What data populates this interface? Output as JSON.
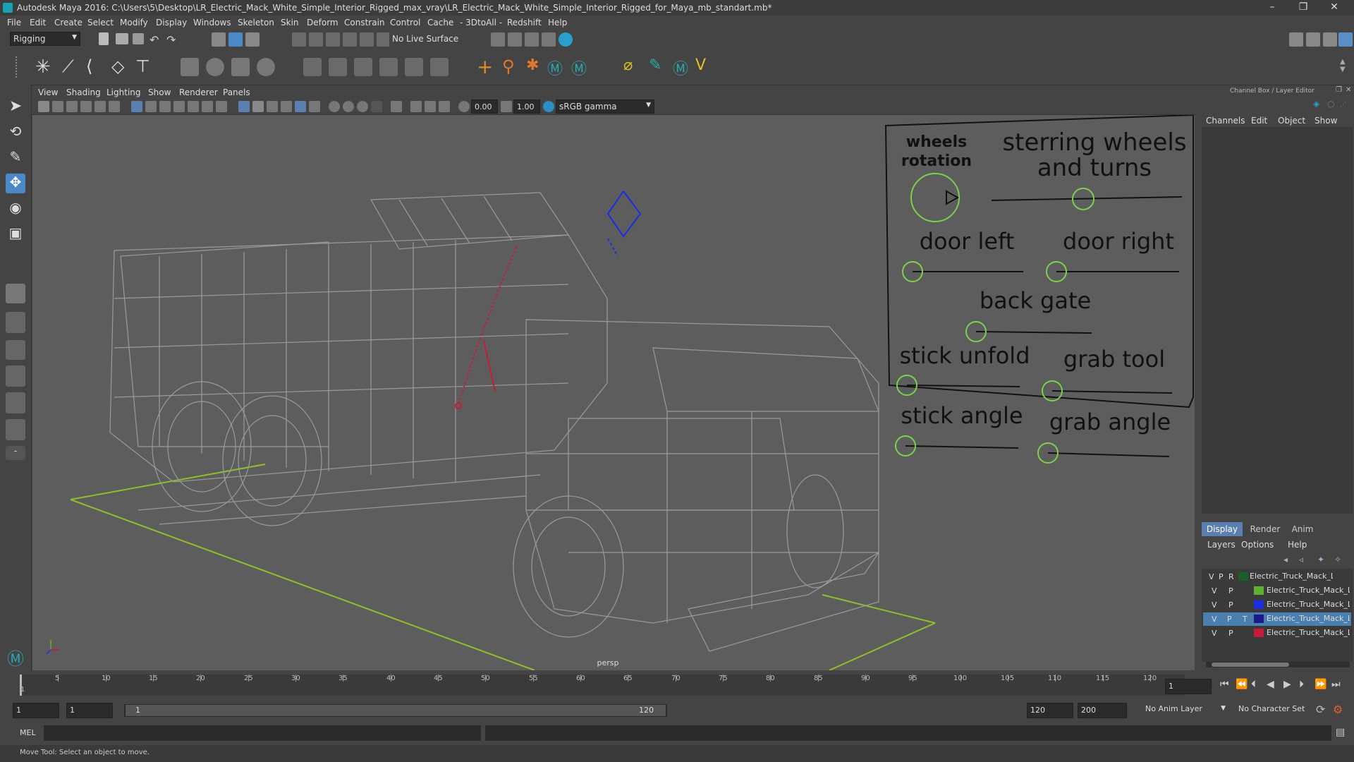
{
  "window": {
    "title": "Autodesk Maya 2016: C:\\Users\\5\\Desktop\\LR_Electric_Mack_White_Simple_Interior_Rigged_max_vray\\LR_Electric_Mack_White_Simple_Interior_Rigged_for_Maya_mb_standart.mb*",
    "minimize": "–",
    "restore": "❐",
    "close": "✕"
  },
  "menu": [
    "File",
    "Edit",
    "Create",
    "Select",
    "Modify",
    "Display",
    "Windows",
    "Skeleton",
    "Skin",
    "Deform",
    "Constrain",
    "Control",
    "Cache",
    "- 3DtoAll -",
    "Redshift",
    "Help"
  ],
  "status_line": {
    "menu_set": "Rigging",
    "live_surface": "No Live Surface"
  },
  "viewport": {
    "menu": [
      "View",
      "Shading",
      "Lighting",
      "Show",
      "Renderer",
      "Panels"
    ],
    "exposure": "0.00",
    "gamma": "1.00",
    "color_space": "sRGB gamma",
    "camera_label": "persp"
  },
  "control_panel": {
    "wheels_rotation": [
      "wheels",
      "rotation"
    ],
    "steering": [
      "sterring wheels",
      "and turns"
    ],
    "door_left": "door left",
    "door_right": "door right",
    "back_gate": "back gate",
    "stick_unfold": "stick unfold",
    "grab_tool": "grab tool",
    "stick_angle": "stick angle",
    "grab_angle": "grab angle"
  },
  "channel_box": {
    "header": "Channel Box / Layer Editor",
    "menu": [
      "Channels",
      "Edit",
      "Object",
      "Show"
    ]
  },
  "layer_editor": {
    "tabs": [
      "Display",
      "Render",
      "Anim"
    ],
    "menu": [
      "Layers",
      "Options",
      "Help"
    ],
    "layers": [
      {
        "v": "V",
        "p": "P",
        "r": "R",
        "color": "#1c5e2a",
        "name": "Electric_Truck_Mack_LR_Blu"
      },
      {
        "v": "V",
        "p": "P",
        "r": "",
        "color": "#5fb030",
        "name": "Electric_Truck_Mack_LR"
      },
      {
        "v": "V",
        "p": "P",
        "r": "",
        "color": "#1a2fe0",
        "name": "Electric_Truck_Mack_LR"
      },
      {
        "v": "V",
        "p": "P",
        "r": "T",
        "color": "#1a1a8a",
        "name": "Electric_Truck_Mack_LR",
        "selected": true
      },
      {
        "v": "V",
        "p": "P",
        "r": "",
        "color": "#c81b3a",
        "name": "Electric_Truck_Mack_LR"
      }
    ]
  },
  "timeline": {
    "ticks": [
      "5",
      "10",
      "15",
      "20",
      "25",
      "30",
      "35",
      "40",
      "45",
      "50",
      "55",
      "60",
      "65",
      "70",
      "75",
      "80",
      "85",
      "90",
      "95",
      "100",
      "105",
      "110",
      "115",
      "120"
    ],
    "first_tick": "1",
    "current_frame": "1"
  },
  "range": {
    "start": "1",
    "playback_start": "1",
    "slider_start": "1",
    "slider_end": "120",
    "playback_end": "120",
    "end": "200",
    "anim_layer": "No Anim Layer",
    "character_set": "No Character Set"
  },
  "command_line": {
    "language": "MEL"
  },
  "help_line": "Move Tool: Select an object to move."
}
